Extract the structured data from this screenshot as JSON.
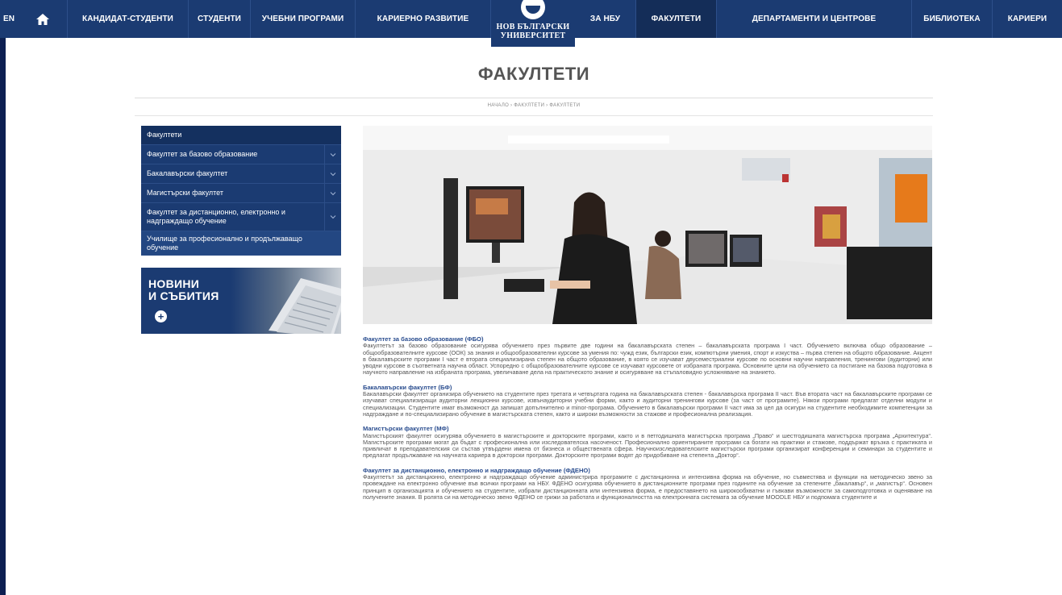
{
  "nav": {
    "lang": "EN",
    "items": [
      "КАНДИДАТ-СТУДЕНТИ",
      "СТУДЕНТИ",
      "УЧЕБНИ ПРОГРАМИ",
      "КАРИЕРНО РАЗВИТИЕ",
      "ЗА НБУ",
      "ФАКУЛТЕТИ",
      "ДЕПАРТАМЕНТИ И ЦЕНТРОВЕ",
      "БИБЛИОТЕКА",
      "КАРИЕРИ"
    ],
    "active": "ФАКУЛТЕТИ"
  },
  "logo": {
    "line1": "НОВ БЪЛГАРСКИ",
    "line2": "УНИВЕРСИТЕТ"
  },
  "page_title": "ФАКУЛТЕТИ",
  "breadcrumb": "НАЧАЛО  ›  ФАКУЛТЕТИ  ›  ФАКУЛТЕТИ",
  "sidebar": {
    "header": "Факултети",
    "items": [
      {
        "label": "Факултет за базово образование"
      },
      {
        "label": "Бакалавърски факултет"
      },
      {
        "label": "Магистърски факултет"
      },
      {
        "label": "Факултет за дистанционно, електронно и надграждащо обучение"
      },
      {
        "label": "Училище за професионално и продължаващо обучение"
      }
    ]
  },
  "news": {
    "line1": "НОВИНИ",
    "line2": "И СЪБИТИЯ",
    "plus": "+"
  },
  "sections": [
    {
      "title": "Факултет за базово образование (ФБО)",
      "body": "Факултетът за базово образование осигурява обучението през първите две години на бакалавърската степен – бакалавърската програма I част. Обучението включва общо образование – общообразователните курсове (ООК) за знания и общообразователни курсове за умения по: чужд език, български език, компютърни умения, спорт и изкуства – първа степен на общото образование. Акцент в бакалавърските програми I част е втората специализирана степен на общото образование, в която се изучават двусеместриални курсове по основни научни направления, тренингови (аудиторни) или уводни курсове в съответната научна област. Успоредно с общообразователните курсове се изучават курсовете от избраната програма. Основните цели на обучението са постигане на базова подготовка в научното направление на избраната програма, увеличаване дела на практическото знание и осигуряване на стъпаловидно усложняване на знанието."
    },
    {
      "title": "Бакалавърски факултет  (БФ)",
      "body": "Бакалавърски факултет организира обучението на студентите през третата и четвъртата година на бакалавърската степен  - бакалавърска програма II част. Във втората част на бакалавърските програми се изучават специализиращи аудиторни лекционни курсове, извънаудиторни учебни форми, както и аудиторни тренингови курсове (за част от програмите).  Някои програми предлагат отделни модули и специализации. Студентите имат възможност да запишат допълнително и minor-програма. Обучението в бакалавърски програми II част има за цел да осигури на студентите необходимите компетенции за надграждане и по-специализирано обучение в магистърската степен, както и широки възможности за стажове и професионална реализация."
    },
    {
      "title": "Магистърски факултет (МФ)",
      "body": "Магистърският факултет осигурява обучението в магистърските и докторските програми, както и в петгодишната магистърска програма „Право“ и шестгодишната магистърска програма „Архитектура“. Магистърските програми могат да бъдат с професионална или изследователска насоченост. Професионално ориентираните програми са богати на практики и стажове, поддържат връзка с практиката и привличат в преподавателския си състав утвърдени имена от бизнеса и обществената сфера. Научноизследователските магистърски програми организират конференции и семинари за студентите и предлагат продължаване на научната кариера в докторски програми. Докторските програми водят до придобиване на степента „Доктор“."
    },
    {
      "title": "Факултет за дистанционно, електронно и надграждащо обучение (ФДЕНО)",
      "body": "Факултетът за дистанционно, електронно и надграждащо обучение администрира програмите с дистанционна и интензивна форма на обучение, но съвместява и функции на методическо звено за провеждане на електронно обучение във всички програми на НБУ. ФДЕНО осигурява обучението в дистанционните програми през годините на обучение за степените „бакалавър“, и „магистър“. Основен принцип в организацията и обучението на студентите, избрали дистанционната или интензивна форма, е предоставянето на широкообхватни и гъвкави възможности за самоподготовка и оценяване на получените знания. В ролята си на методическо звено ФДЕНО се грижи за работата и функционалността на електронната системата за обучение MOODLE НБУ и подпомага студентите и"
    }
  ],
  "colors": {
    "nav_bg": "#1b3b72",
    "accent": "#2a4d8f",
    "frame": "#0d1f52"
  },
  "icons": {
    "home": "home-icon",
    "chevron": "chevron-down-icon",
    "plus": "plus-icon"
  }
}
